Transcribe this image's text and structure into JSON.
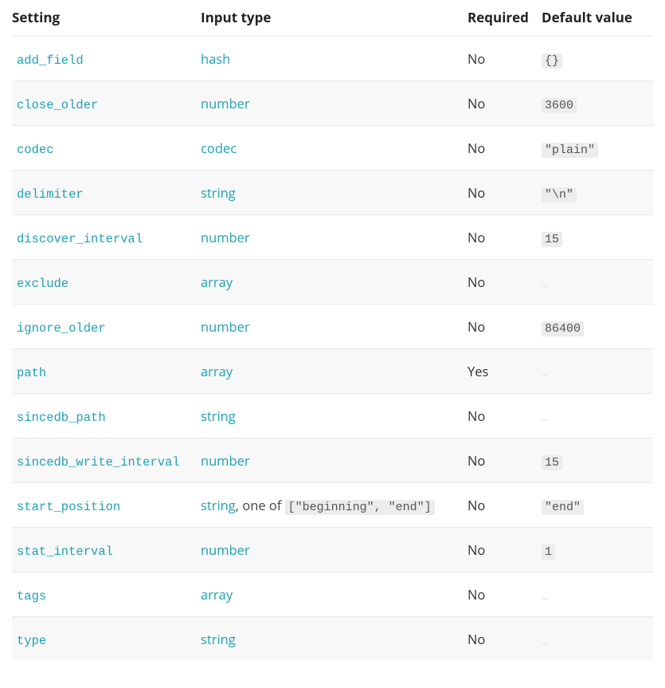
{
  "headers": {
    "setting": "Setting",
    "type": "Input type",
    "required": "Required",
    "default": "Default value"
  },
  "rows": [
    {
      "setting": "add_field",
      "type": "hash",
      "type_suffix": "",
      "type_code": "",
      "required": "No",
      "default": "{}"
    },
    {
      "setting": "close_older",
      "type": "number",
      "type_suffix": "",
      "type_code": "",
      "required": "No",
      "default": "3600"
    },
    {
      "setting": "codec",
      "type": "codec",
      "type_suffix": "",
      "type_code": "",
      "required": "No",
      "default": "\"plain\""
    },
    {
      "setting": "delimiter",
      "type": "string",
      "type_suffix": "",
      "type_code": "",
      "required": "No",
      "default": "\"\\n\""
    },
    {
      "setting": "discover_interval",
      "type": "number",
      "type_suffix": "",
      "type_code": "",
      "required": "No",
      "default": "15"
    },
    {
      "setting": "exclude",
      "type": "array",
      "type_suffix": "",
      "type_code": "",
      "required": "No",
      "default": ""
    },
    {
      "setting": "ignore_older",
      "type": "number",
      "type_suffix": "",
      "type_code": "",
      "required": "No",
      "default": "86400"
    },
    {
      "setting": "path",
      "type": "array",
      "type_suffix": "",
      "type_code": "",
      "required": "Yes",
      "default": ""
    },
    {
      "setting": "sincedb_path",
      "type": "string",
      "type_suffix": "",
      "type_code": "",
      "required": "No",
      "default": ""
    },
    {
      "setting": "sincedb_write_interval",
      "type": "number",
      "type_suffix": "",
      "type_code": "",
      "required": "No",
      "default": "15"
    },
    {
      "setting": "start_position",
      "type": "string",
      "type_suffix": ", one of ",
      "type_code": "[\"beginning\", \"end\"]",
      "required": "No",
      "default": "\"end\""
    },
    {
      "setting": "stat_interval",
      "type": "number",
      "type_suffix": "",
      "type_code": "",
      "required": "No",
      "default": "1"
    },
    {
      "setting": "tags",
      "type": "array",
      "type_suffix": "",
      "type_code": "",
      "required": "No",
      "default": ""
    },
    {
      "setting": "type",
      "type": "string",
      "type_suffix": "",
      "type_code": "",
      "required": "No",
      "default": ""
    }
  ]
}
